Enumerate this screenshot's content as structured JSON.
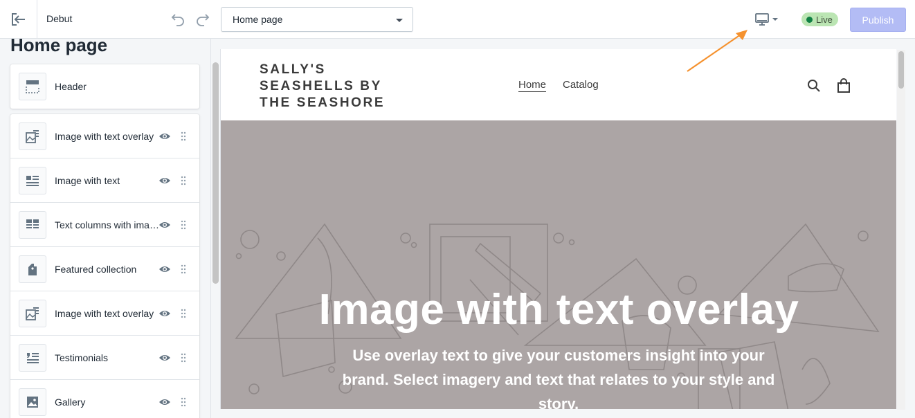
{
  "topbar": {
    "theme_name": "Debut",
    "page_select": "Home page",
    "live_badge": "Live",
    "publish_label": "Publish"
  },
  "sidebar": {
    "title": "Home page",
    "header_item": {
      "label": "Header",
      "icon": "header-layout-icon"
    },
    "sections": [
      {
        "label": "Image with text overlay",
        "icon": "image-overlay-icon"
      },
      {
        "label": "Image with text",
        "icon": "image-text-icon"
      },
      {
        "label": "Text columns with images",
        "icon": "text-columns-icon"
      },
      {
        "label": "Featured collection",
        "icon": "collection-tag-icon"
      },
      {
        "label": "Image with text overlay",
        "icon": "image-overlay-icon"
      },
      {
        "label": "Testimonials",
        "icon": "quote-icon"
      },
      {
        "label": "Gallery",
        "icon": "gallery-image-icon"
      }
    ]
  },
  "preview": {
    "store_name": "SALLY'S SEASHELLS BY THE SEASHORE",
    "nav": [
      "Home",
      "Catalog"
    ],
    "hero_title": "Image with text overlay",
    "hero_subtitle": "Use overlay text to give your customers insight into your brand. Select imagery and text that relates to your style and story."
  },
  "colors": {
    "publish_bg": "#b3bcf5",
    "live_badge_bg": "#bbe5b3",
    "live_dot": "#108043",
    "hero_bg": "#aca5a5",
    "annotation_arrow": "#f5922f"
  }
}
